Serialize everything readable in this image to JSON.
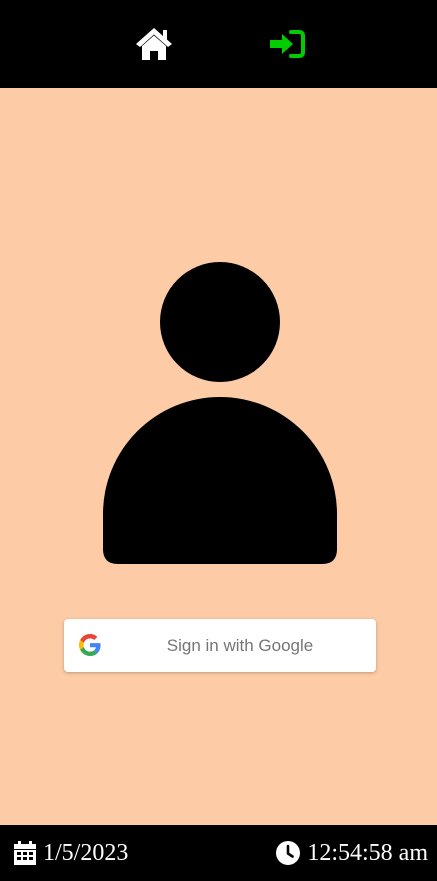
{
  "nav": {
    "home_icon": "home-icon",
    "login_icon": "sign-in-icon",
    "active_color": "#00cc00"
  },
  "main": {
    "avatar_icon": "user-icon",
    "google_button": {
      "label": "Sign in with Google",
      "icon": "google-logo-icon"
    },
    "background_color": "#fdcba5"
  },
  "footer": {
    "date": "1/5/2023",
    "time": "12:54:58 am",
    "date_icon": "calendar-icon",
    "time_icon": "clock-icon"
  }
}
